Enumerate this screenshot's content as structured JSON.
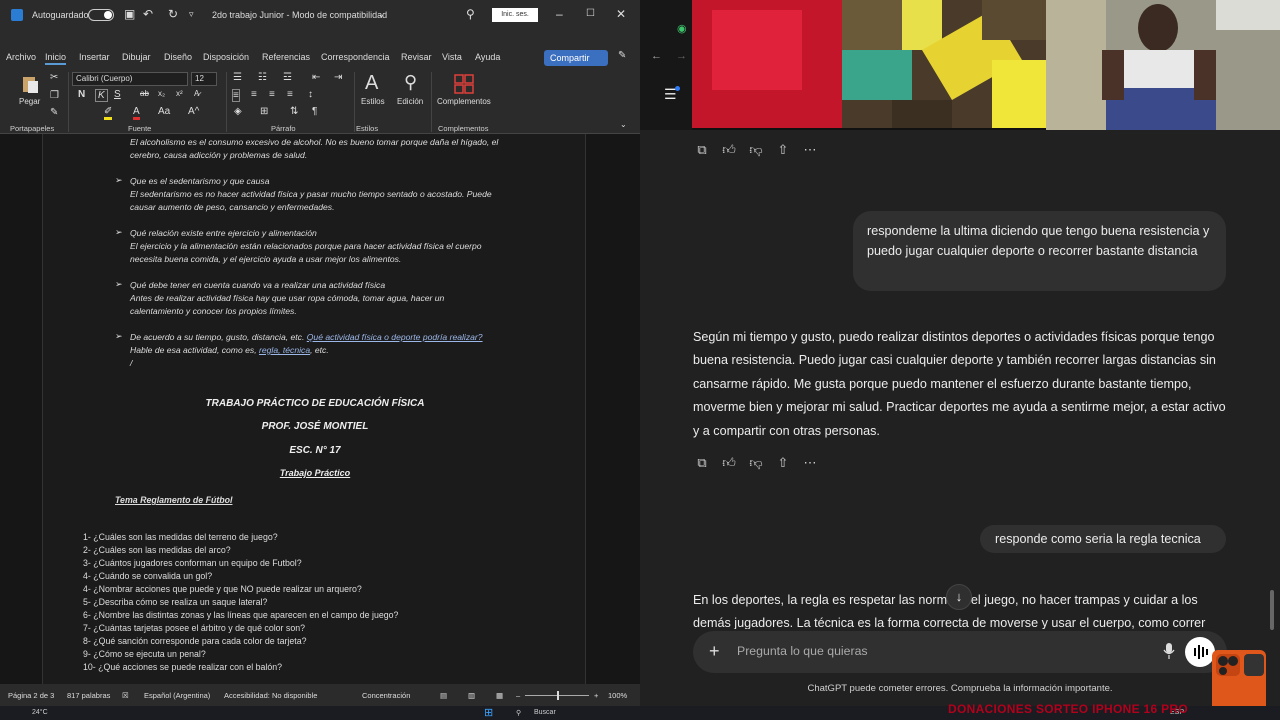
{
  "word": {
    "autosave_label": "Autoguardado",
    "doc_title": "2do trabajo Junior  -  Modo de compatibilidad",
    "signin_label": "Inic. ses.",
    "share_label": "Compartir",
    "tabs": [
      "Archivo",
      "Inicio",
      "Insertar",
      "Dibujar",
      "Diseño",
      "Disposición",
      "Referencias",
      "Correspondencia",
      "Revisar",
      "Vista",
      "Ayuda"
    ],
    "ribbon": {
      "font_name": "Calibri (Cuerpo)",
      "font_size": "12",
      "paste_label": "Pegar",
      "styles_label": "Estilos",
      "editing_label": "Edición",
      "addins_label": "Complementos",
      "group_clipboard": "Portapapeles",
      "group_font": "Fuente",
      "group_paragraph": "Párrafo",
      "group_styles": "Estilos",
      "group_addins": "Complementos"
    },
    "doc": {
      "p1_answer_l1": "El alcoholismo es el consumo excesivo de alcohol. No es bueno tomar porque daña el hígado, el",
      "p1_answer_l2": "cerebro, causa adicción y problemas de salud.",
      "q2": "Que es el sedentarismo y que causa",
      "a2_l1": "El sedentarismo es no hacer actividad física y pasar mucho tiempo sentado o acostado. Puede",
      "a2_l2": "causar aumento de peso, cansancio y enfermedades.",
      "q3": "Qué relación existe entre ejercicio y alimentación",
      "a3_l1": "El ejercicio y la alimentación están relacionados porque para hacer actividad física el cuerpo",
      "a3_l2": "necesita buena comida, y el ejercicio ayuda a usar mejor los alimentos.",
      "q4": "Qué debe tener en cuenta cuando va a realizar una actividad física",
      "a4_l1": "Antes de realizar actividad física hay que usar ropa cómoda, tomar agua, hacer un",
      "a4_l2": "calentamiento y conocer los propios límites.",
      "q5_pre": "De acuerdo a su tiempo, gusto, distancia, etc. ",
      "q5_link": "Qué actividad física o deporte podría realizar?",
      "q5_l2_pre": "Hable de esa actividad, como es, ",
      "q5_l2_link": "regla,  técnica",
      "q5_l2_post": ", etc.",
      "cursor": "/",
      "title1": "TRABAJO PRÁCTICO DE EDUCACIÓN FÍSICA",
      "title2": "PROF. JOSÉ MONTIEL",
      "title3": "ESC. N° 17",
      "title4": "Trabajo Práctico",
      "topic": "Tema Reglamento de Fútbol",
      "questions": [
        "1- ¿Cuáles son las medidas del terreno de juego?",
        "2- ¿Cuáles son las medidas del arco?",
        "3- ¿Cuántos jugadores conforman un equipo de Futbol?",
        "4- ¿Cuándo se convalida un gol?",
        "4- ¿Nombrar acciones que puede y que NO puede realizar un arquero?",
        "5- ¿Describa cómo se realiza un saque lateral?",
        "6- ¿Nombre las distintas zonas y las líneas que aparecen en el campo de juego?",
        "7- ¿Cuántas tarjetas posee el árbitro y de qué color son?",
        "8- ¿Qué sanción corresponde para cada color de tarjeta?",
        "9- ¿Cómo se ejecuta un penal?",
        "10- ¿Qué acciones se puede realizar con el balón?"
      ]
    },
    "status": {
      "page": "Página 2 de 3",
      "words": "817 palabras",
      "language": "Español (Argentina)",
      "accessibility": "Accesibilidad: No disponible",
      "focus": "Concentración",
      "zoom": "100%"
    }
  },
  "chat": {
    "user_msg_1": "respondeme la ultima diciendo que tengo buena resistencia y puedo jugar cualquier deporte o recorrer bastante distancia",
    "assistant_msg_1": "Según mi tiempo y gusto, puedo realizar distintos deportes o actividades físicas porque tengo buena resistencia. Puedo jugar casi cualquier deporte y también recorrer largas distancias sin cansarme rápido. Me gusta porque puedo mantener el esfuerzo durante bastante tiempo, moverme bien y mejorar mi salud. Practicar deportes me ayuda a sentirme mejor, a estar activo y a compartir con otras personas.",
    "user_msg_2": "responde como seria la regla tecnica",
    "assistant_msg_2": "En los deportes, la regla es respetar las normas del juego, no hacer trampas y cuidar a los demás jugadores. La técnica es la forma correcta de moverse y usar el cuerpo, como correr",
    "composer_placeholder": "Pregunta lo que quieras",
    "disclaimer": "ChatGPT puede cometer errores. Comprueba la información importante."
  },
  "taskbar": {
    "weather": "24°C",
    "search_label": "Buscar",
    "lang": "ESP"
  },
  "overlay": {
    "donations": "DONACIONES SORTEO IPHONE 16 PRO"
  },
  "colors": {
    "word_bg": "#1f1f1f",
    "chat_bg": "#212121",
    "user_bubble": "#303030",
    "accent_blue": "#3b6fbf",
    "donation_red": "#b3001b"
  }
}
